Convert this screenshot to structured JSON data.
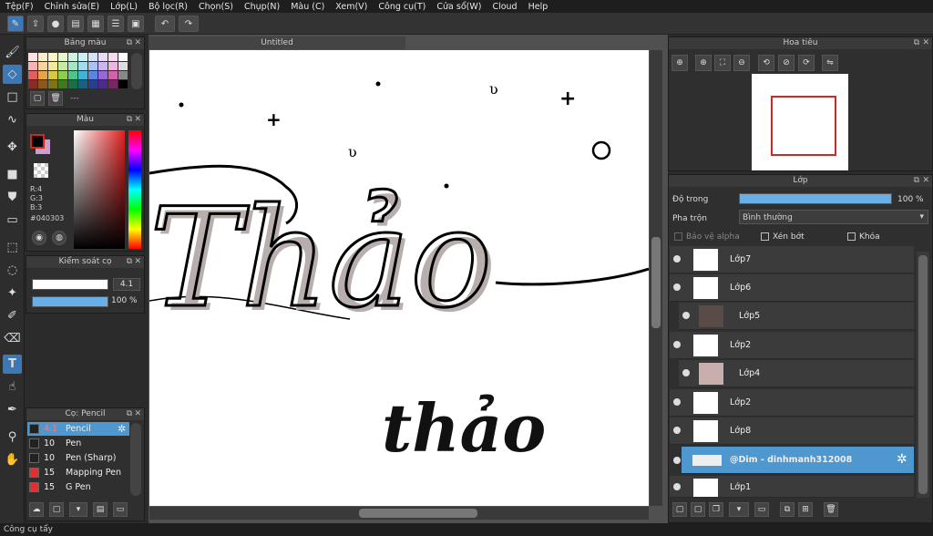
{
  "menu": [
    "Tệp(F)",
    "Chỉnh sửa(E)",
    "Lớp(L)",
    "Bộ lọc(R)",
    "Chọn(S)",
    "Chụp(N)",
    "Màu (C)",
    "Xem(V)",
    "Công cụ(T)",
    "Cửa sổ(W)",
    "Cloud",
    "Help"
  ],
  "document": {
    "tab_title": "Untitled"
  },
  "palette_panel": {
    "title": "Bảng màu",
    "footer_text": "---"
  },
  "color_panel": {
    "title": "Màu",
    "r": "R:4",
    "g": "G:3",
    "b": "B:3",
    "hex": "#040303",
    "current_color": "#040303"
  },
  "brush_control": {
    "title": "Kiểm soát cọ",
    "size": "4.1",
    "opacity": "100 %"
  },
  "brush_panel": {
    "title": "Cọ: Pencil",
    "brushes": [
      {
        "size": "4.1",
        "name": "Pencil",
        "color": "#222222",
        "selected": true
      },
      {
        "size": "10",
        "name": "Pen",
        "color": "#222222"
      },
      {
        "size": "10",
        "name": "Pen (Sharp)",
        "color": "#222222"
      },
      {
        "size": "15",
        "name": "Mapping Pen",
        "color": "#e03030"
      },
      {
        "size": "15",
        "name": "G Pen",
        "color": "#e03030"
      }
    ]
  },
  "navigator": {
    "title": "Hoa tiêu"
  },
  "layers_panel": {
    "title": "Lớp",
    "opacity_label": "Độ trong",
    "opacity_value": "100 %",
    "blend_label": "Pha trộn",
    "blend_value": "Bình thường",
    "protect_alpha": "Bảo vệ alpha",
    "clipping": "Xén bớt",
    "lock": "Khóa",
    "layers": [
      {
        "name": "Lớp7"
      },
      {
        "name": "Lớp6"
      },
      {
        "name": "Lớp5"
      },
      {
        "name": "Lớp2"
      },
      {
        "name": "Lớp4"
      },
      {
        "name": "Lớp2"
      },
      {
        "name": "Lớp8"
      },
      {
        "name": "@Dim - dinhmanh312008",
        "selected": true
      },
      {
        "name": "Lớp1"
      }
    ]
  },
  "canvas_text": {
    "big_word": "Thảo",
    "small_word": "thảo"
  },
  "status": "Công cụ tẩy"
}
